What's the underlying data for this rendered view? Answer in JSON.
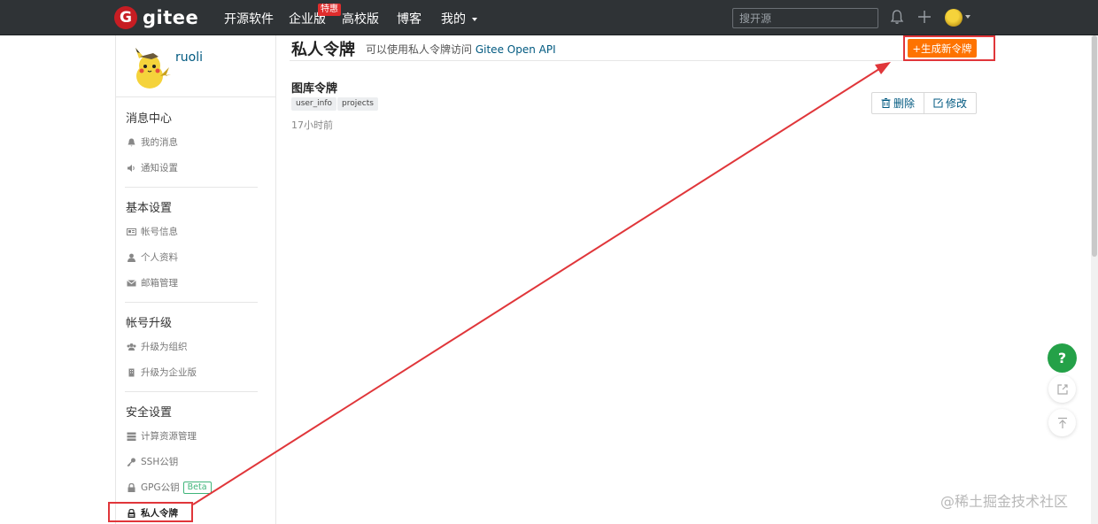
{
  "topnav": {
    "logo_letter": "G",
    "logo_text": "gitee",
    "items": [
      "开源软件",
      "企业版",
      "高校版",
      "博客",
      "我的"
    ],
    "badge": "特惠",
    "search_placeholder": "搜开源"
  },
  "sidebar": {
    "username": "ruoli",
    "sections": [
      {
        "title": "消息中心",
        "items": [
          {
            "label": "我的消息",
            "icon": "bell-icon"
          },
          {
            "label": "通知设置",
            "icon": "speaker-icon"
          }
        ]
      },
      {
        "title": "基本设置",
        "items": [
          {
            "label": "帐号信息",
            "icon": "id-card-icon"
          },
          {
            "label": "个人资料",
            "icon": "user-icon"
          },
          {
            "label": "邮箱管理",
            "icon": "mail-icon"
          }
        ]
      },
      {
        "title": "帐号升级",
        "items": [
          {
            "label": "升级为组织",
            "icon": "group-icon"
          },
          {
            "label": "升级为企业版",
            "icon": "building-icon"
          }
        ]
      },
      {
        "title": "安全设置",
        "items": [
          {
            "label": "计算资源管理",
            "icon": "server-icon"
          },
          {
            "label": "SSH公钥",
            "icon": "key-icon"
          },
          {
            "label": "GPG公钥",
            "icon": "lock-icon",
            "badge": "Beta"
          },
          {
            "label": "私人令牌",
            "icon": "token-icon",
            "active": true
          }
        ]
      }
    ]
  },
  "main": {
    "title": "私人令牌",
    "subtitle_prefix": "可以使用私人令牌访问",
    "subtitle_link": "Gitee Open API",
    "generate_button": "+生成新令牌",
    "token": {
      "name": "图库令牌",
      "scopes": [
        "user_info",
        "projects"
      ],
      "time": "17小时前",
      "delete_label": "删除",
      "edit_label": "修改"
    }
  },
  "float": {
    "help": "?"
  },
  "watermark": "@稀土掘金技术社区",
  "colors": {
    "accent": "#fe7300",
    "link": "#005980",
    "annotation": "#e0363a",
    "help": "#24a148"
  }
}
